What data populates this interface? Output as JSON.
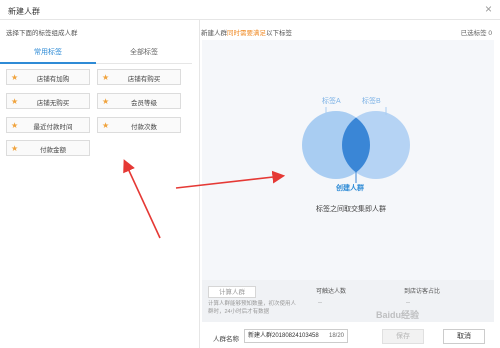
{
  "dialog": {
    "title": "新建人群",
    "close_icon": "×"
  },
  "left": {
    "heading": "选择下面的标签组成人群",
    "tabs": [
      {
        "label": "常用标签",
        "active": true
      },
      {
        "label": "全部标签",
        "active": false
      }
    ],
    "tags": [
      {
        "label": "店铺有加购"
      },
      {
        "label": "店铺有购买"
      },
      {
        "label": "店铺无购买"
      },
      {
        "label": "会员等级"
      },
      {
        "label": "最近付款时间"
      },
      {
        "label": "付款次数"
      },
      {
        "label": "付款金额"
      }
    ],
    "star_color": "#f0a23b"
  },
  "right": {
    "heading_prefix": "新建人群",
    "heading_warn": "同时需要满足",
    "heading_suffix": "以下标签",
    "selected_label": "已选标签",
    "selected_count": "0",
    "venn": {
      "label_a": "标签A",
      "label_b": "标签B",
      "create_label": "创建人群",
      "caption": "标签之间取交集即人群"
    },
    "colors": {
      "circle": "#a9cdf2",
      "intersection": "#3a86d6",
      "accent": "#2e8bd6",
      "warn": "#f08a24"
    }
  },
  "info": {
    "calc_button": "计算人群",
    "calc_hint": "计算人群能够预知数量，初次使用人群时，24小时后才有数据",
    "reach_label": "可触达人数",
    "reach_value": "--",
    "ratio_label": "到店访客占比",
    "ratio_value": "--"
  },
  "footer": {
    "name_label": "人群名称",
    "name_value": "新建人群20180824103458",
    "name_count": "18/20",
    "save": "保存",
    "cancel": "取消"
  },
  "watermark": "Baidu经验"
}
